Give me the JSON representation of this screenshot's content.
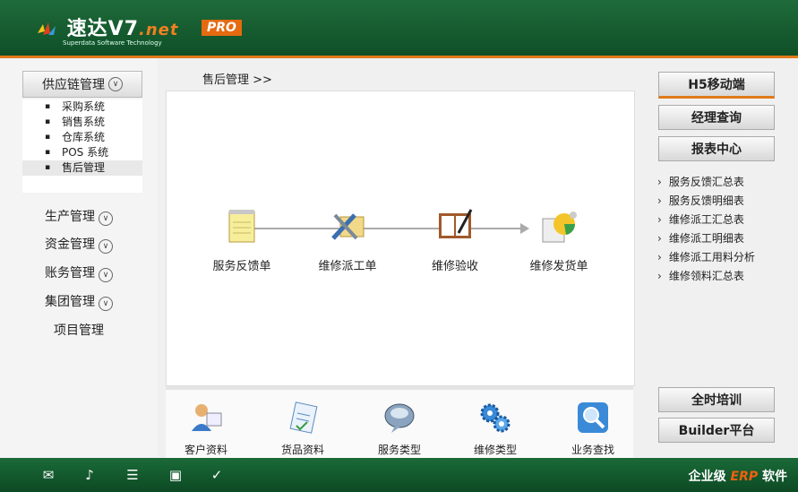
{
  "header": {
    "brand": "速达V7",
    "brand_suffix": ".net",
    "tagline": "Superdata Software Technology",
    "badge": "PRO"
  },
  "left": {
    "group_label": "供应链管理",
    "subitems": [
      "采购系统",
      "销售系统",
      "仓库系统",
      "POS 系统",
      "售后管理"
    ],
    "selected_index": 4,
    "nav": [
      "生产管理",
      "资金管理",
      "账务管理",
      "集团管理",
      "项目管理"
    ]
  },
  "breadcrumb": "售后管理  >>",
  "flow": {
    "steps": [
      "服务反馈单",
      "维修派工单",
      "维修验收",
      "维修发货单"
    ]
  },
  "tools": [
    "客户资料",
    "货品资料",
    "服务类型",
    "维修类型",
    "业务查找"
  ],
  "right": {
    "buttons": [
      "H5移动端",
      "经理查询",
      "报表中心"
    ],
    "links": [
      "服务反馈汇总表",
      "服务反馈明细表",
      "维修派工汇总表",
      "维修派工明细表",
      "维修派工用料分析",
      "维修领料汇总表"
    ],
    "bottom_buttons": [
      "全时培训",
      "Builder平台"
    ]
  },
  "footer": {
    "slogan_pre": "企业级",
    "slogan_erp": "ERP",
    "slogan_post": "软件",
    "icons": [
      "mail-icon",
      "speaker-icon",
      "book-icon",
      "window-icon",
      "check-icon"
    ]
  },
  "colors": {
    "header_green": "#1f6b3a",
    "accent_orange": "#e07a1a"
  }
}
